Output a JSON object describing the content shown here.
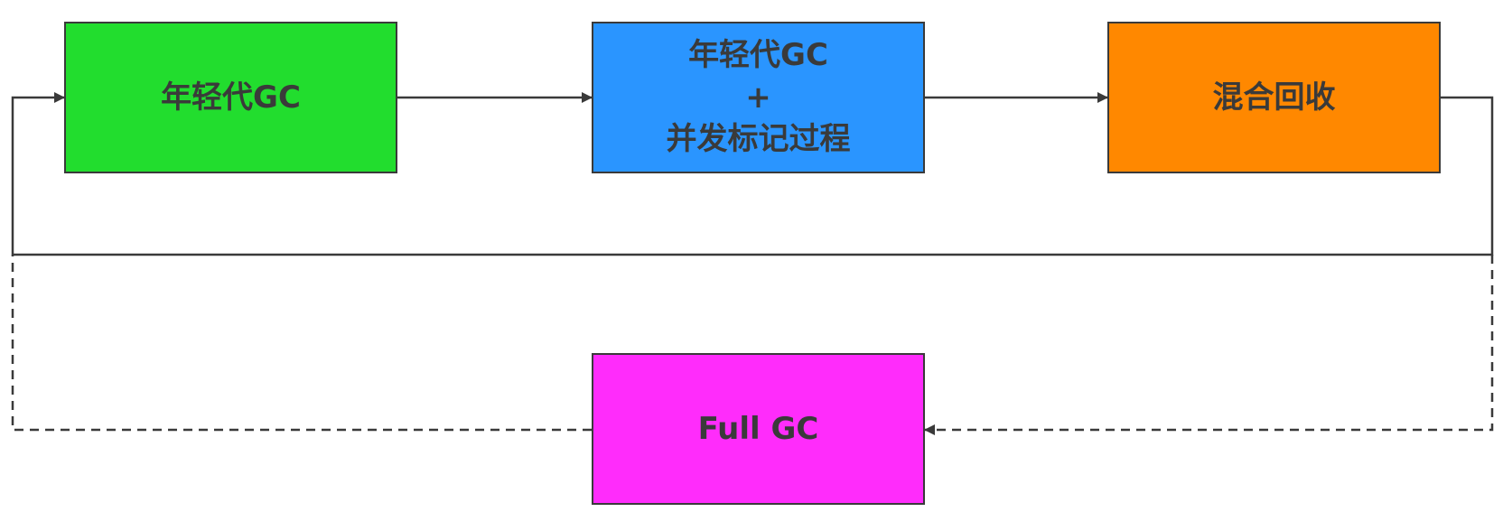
{
  "nodes": {
    "young_gc": {
      "label": "年轻代GC",
      "color": "#22dd2e"
    },
    "young_gc_concurrent_mark": {
      "lines": [
        "年轻代GC",
        "+",
        "并发标记过程"
      ],
      "color": "#2a95ff"
    },
    "mixed_gc": {
      "label": "混合回收",
      "color": "#ff8800"
    },
    "full_gc": {
      "label": "Full GC",
      "color": "#ff2cfb"
    }
  },
  "edges": [
    {
      "from": "young_gc",
      "to": "young_gc_concurrent_mark",
      "style": "solid"
    },
    {
      "from": "young_gc_concurrent_mark",
      "to": "mixed_gc",
      "style": "solid"
    },
    {
      "from": "mixed_gc",
      "to": "young_gc",
      "style": "solid"
    },
    {
      "from": "mixed_gc",
      "to": "full_gc",
      "style": "dashed"
    },
    {
      "from": "full_gc",
      "to": "young_gc",
      "style": "dashed"
    }
  ],
  "colors": {
    "stroke": "#3a3a3a",
    "text": "#3a3a3a",
    "background": "#ffffff"
  }
}
